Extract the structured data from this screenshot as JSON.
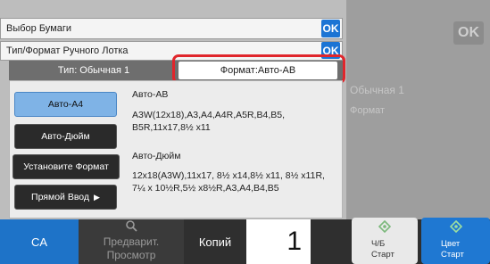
{
  "background": {
    "ok_label": "OK",
    "ghost_type": "Обычная 1",
    "ghost_format": "Формат"
  },
  "dialog": {
    "title": "Выбор Бумаги",
    "ok_label": "OK",
    "tray_title": "Тип/Формат Ручного Лотка",
    "tray_ok_label": "OK",
    "type_tab": "Тип:  Обычная 1",
    "format_tab": "Формат:Авто-AB"
  },
  "options": {
    "auto_a4": "Авто-A4",
    "auto_inch": "Авто-Дюйм",
    "set_format": "Установите Формат",
    "direct_input": "Прямой Ввод"
  },
  "info": {
    "ab_title": "Авто-AB",
    "ab_line1": "A3W(12x18),A3,A4,A4R,A5R,B4,B5,",
    "ab_line2": "B5R,11x17,8½ x11",
    "inch_title": "Авто-Дюйм",
    "inch_line1": "12x18(A3W),11x17, 8½ x14,8½ x11, 8½ x11R,",
    "inch_line2": "7¼ x 10½R,5½ x8½R,A3,A4,B4,B5"
  },
  "bottom": {
    "ca_label": "CA",
    "preview_line1": "Предварит.",
    "preview_line2": "Просмотр",
    "copies_label": "Копий",
    "copies_value": "1",
    "bw_line1": "Ч/Б",
    "bw_line2": "Старт",
    "color_line1": "Цвет",
    "color_line2": "Старт"
  },
  "colors": {
    "accent_blue": "#1b74d4",
    "highlight_red": "#e0262c",
    "selected_option": "#7fb3e6"
  },
  "icons": [
    "arrow-right-icon",
    "magnifier-icon",
    "start-diamond-icon"
  ]
}
